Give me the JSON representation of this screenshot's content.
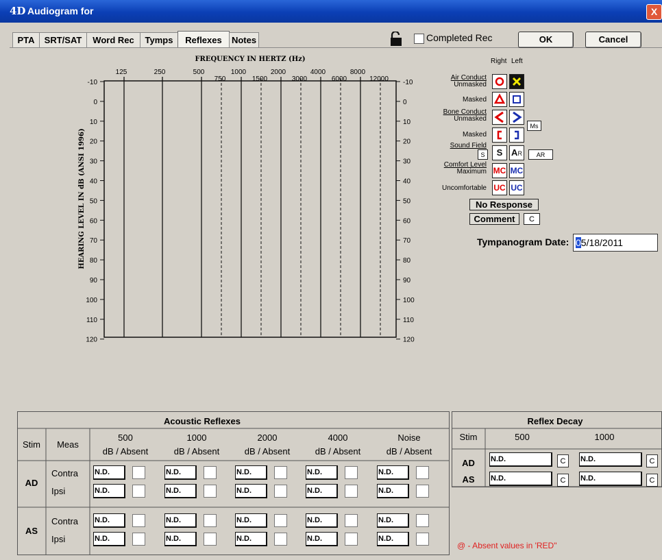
{
  "window": {
    "logo": "4D",
    "title": "Audiogram for",
    "close": "X"
  },
  "tabs": [
    "PTA",
    "SRT/SAT",
    "Word Rec",
    "Tymps",
    "Reflexes",
    "Notes"
  ],
  "active_tab": "Reflexes",
  "toolbar": {
    "completed_label": "Completed Rec",
    "ok": "OK",
    "cancel": "Cancel"
  },
  "audiogram": {
    "title": "FREQUENCY IN HERTZ (Hz)",
    "ylabel": "HEARING LEVEL IN dB (ANSI 1996)",
    "freq_top": [
      "125",
      "250",
      "500",
      "1000",
      "2000",
      "4000",
      "8000"
    ],
    "freq_bottom": [
      "750",
      "1500",
      "3000",
      "6000",
      "12000"
    ],
    "db_levels": [
      "-10",
      "0",
      "10",
      "20",
      "30",
      "40",
      "50",
      "60",
      "70",
      "80",
      "90",
      "100",
      "110",
      "120"
    ]
  },
  "legend": {
    "right": "Right",
    "left": "Left",
    "air_conduct": "Air Conduct",
    "unmasked": "Unmasked",
    "masked": "Masked",
    "bone_conduct": "Bone Conduct",
    "unmasked2": "Unmasked",
    "masked2": "Masked",
    "sound_field": "Sound Field",
    "comfort_level": "Comfort Level",
    "maximum": "Maximum",
    "uncomfortable": "Uncomfortable",
    "sf_s_btn": "S",
    "sf_right": "S",
    "sf_left": "A",
    "sf_left_sub": "R",
    "ar_btn": "AR",
    "ms_btn": "Ms",
    "mc": "MC",
    "uc": "UC",
    "no_response": "No Response",
    "comment": "Comment",
    "comment_btn": "C",
    "right_color": "#e00000",
    "left_color": "#1a2fb0"
  },
  "tympanogram": {
    "label": "Tympanogram Date:",
    "date_caret": "0",
    "date_rest": "5/18/2011"
  },
  "acoustic_reflexes": {
    "title": "Acoustic Reflexes",
    "stim": "Stim",
    "meas": "Meas",
    "freqs": [
      "500",
      "1000",
      "2000",
      "4000",
      "Noise"
    ],
    "unit": "dB / Absent",
    "ears": [
      {
        "ear": "AD",
        "rows": [
          {
            "meas": "Contra",
            "values": [
              "N.D.",
              "N.D.",
              "N.D.",
              "N.D.",
              "N.D."
            ]
          },
          {
            "meas": "Ipsi",
            "values": [
              "N.D.",
              "N.D.",
              "N.D.",
              "N.D.",
              "N.D."
            ]
          }
        ]
      },
      {
        "ear": "AS",
        "rows": [
          {
            "meas": "Contra",
            "values": [
              "N.D.",
              "N.D.",
              "N.D.",
              "N.D.",
              "N.D."
            ]
          },
          {
            "meas": "Ipsi",
            "values": [
              "N.D.",
              "N.D.",
              "N.D.",
              "N.D.",
              "N.D."
            ]
          }
        ]
      }
    ]
  },
  "reflex_decay": {
    "title": "Reflex Decay",
    "stim": "Stim",
    "freqs": [
      "500",
      "1000"
    ],
    "rows": [
      {
        "ear": "AD",
        "values": [
          "N.D.",
          "N.D."
        ]
      },
      {
        "ear": "AS",
        "values": [
          "N.D.",
          "N.D."
        ]
      }
    ],
    "c_btn": "C"
  },
  "footnote": "@ - Absent values in 'RED\""
}
